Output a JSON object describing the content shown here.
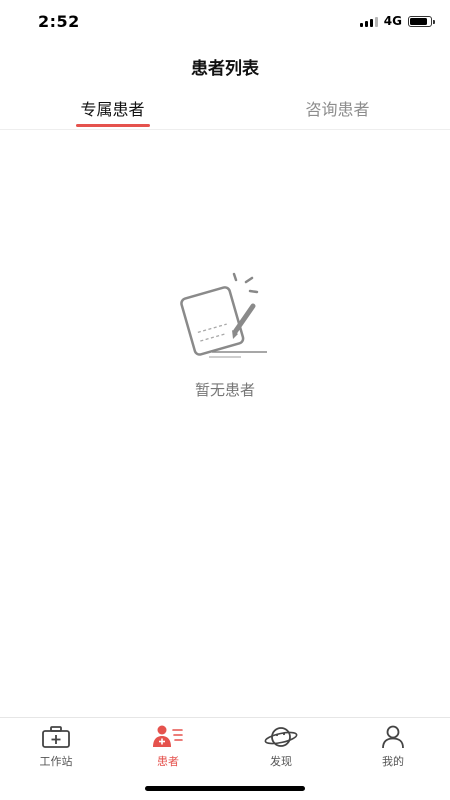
{
  "status_bar": {
    "time": "2:52",
    "network": "4G",
    "battery_level": 0.85
  },
  "header": {
    "title": "患者列表"
  },
  "tabs": [
    {
      "label": "专属患者",
      "active": true
    },
    {
      "label": "咨询患者",
      "active": false
    }
  ],
  "empty_state": {
    "icon": "notepad-pencil-icon",
    "message": "暂无患者"
  },
  "tabbar": {
    "items": [
      {
        "label": "工作站",
        "icon": "medical-kit-icon",
        "active": false
      },
      {
        "label": "患者",
        "icon": "patient-list-icon",
        "active": true
      },
      {
        "label": "发现",
        "icon": "planet-icon",
        "active": false
      },
      {
        "label": "我的",
        "icon": "user-icon",
        "active": false
      }
    ]
  },
  "colors": {
    "accent": "#e5524d",
    "inactive_text": "#8d8d8d",
    "empty_text": "#777777"
  }
}
